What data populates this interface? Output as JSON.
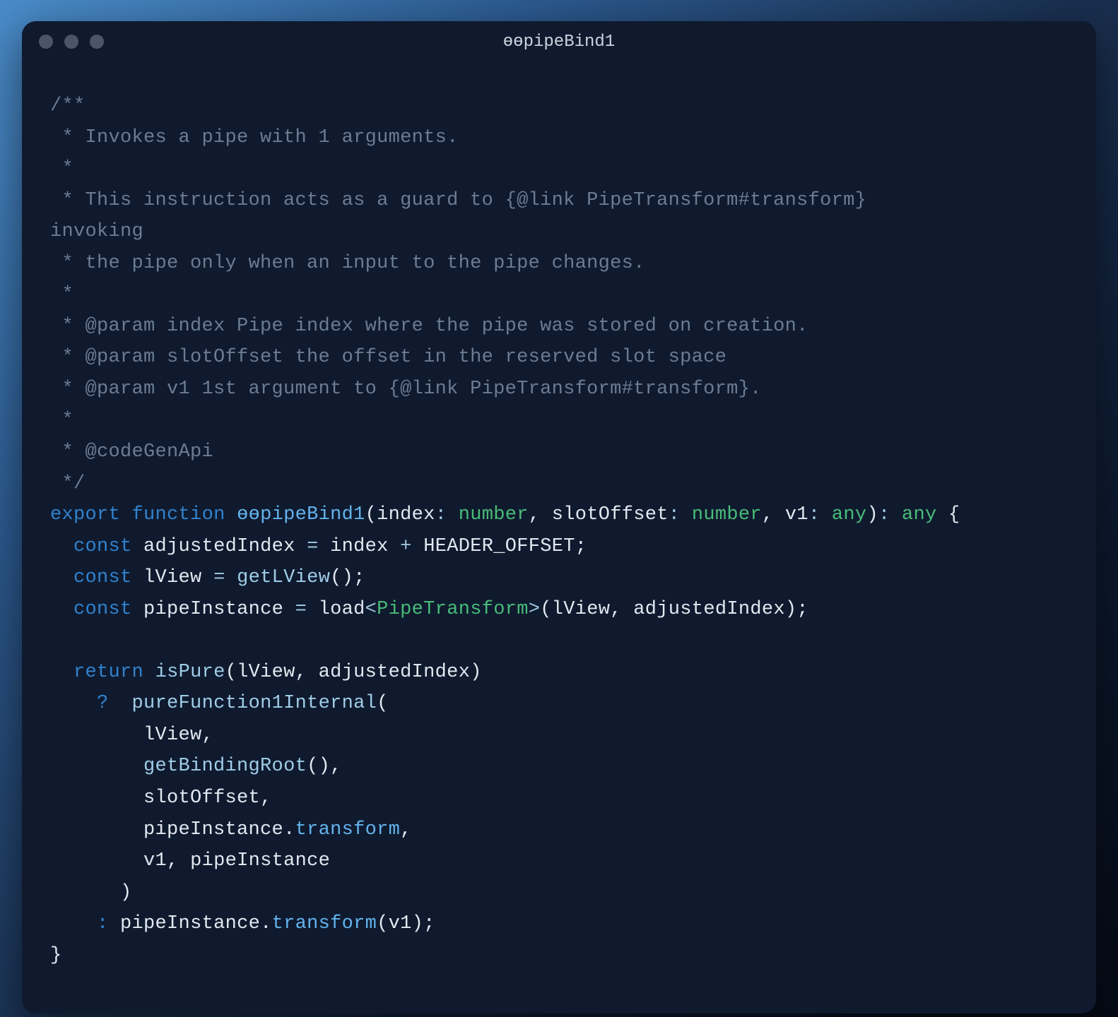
{
  "window": {
    "title": "ɵɵpipeBind1"
  },
  "code": {
    "c1": "/**",
    "c2": " * Invokes a pipe with 1 arguments.",
    "c3": " *",
    "c4": " * This instruction acts as a guard to {@link PipeTransform#transform}",
    "c4b": "invoking",
    "c4c": " * the pipe only when an input to the pipe changes.",
    "c5": " *",
    "c6": " * @param index Pipe index where the pipe was stored on creation.",
    "c7": " * @param slotOffset the offset in the reserved slot space",
    "c8": " * @param v1 1st argument to {@link PipeTransform#transform}.",
    "c9": " *",
    "c10": " * @codeGenApi",
    "c11": " */",
    "kw_export": "export",
    "kw_function": "function",
    "fn_name": "ɵɵpipeBind1",
    "p_index": "index",
    "p_slotOffset": "slotOffset",
    "p_v1": "v1",
    "t_number": "number",
    "t_any": "any",
    "kw_const": "const",
    "v_adjustedIndex": "adjustedIndex",
    "v_index2": "index",
    "v_HEADER_OFFSET": "HEADER_OFFSET",
    "v_lView": "lView",
    "fn_getLView": "getLView",
    "v_pipeInstance": "pipeInstance",
    "fn_load": "load",
    "t_PipeTransform": "PipeTransform",
    "kw_return": "return",
    "fn_isPure": "isPure",
    "fn_pureFunction1Internal": "pureFunction1Internal",
    "fn_getBindingRoot": "getBindingRoot",
    "v_slotOffset2": "slotOffset",
    "prop_transform": "transform",
    "v_v1_2": "v1"
  }
}
